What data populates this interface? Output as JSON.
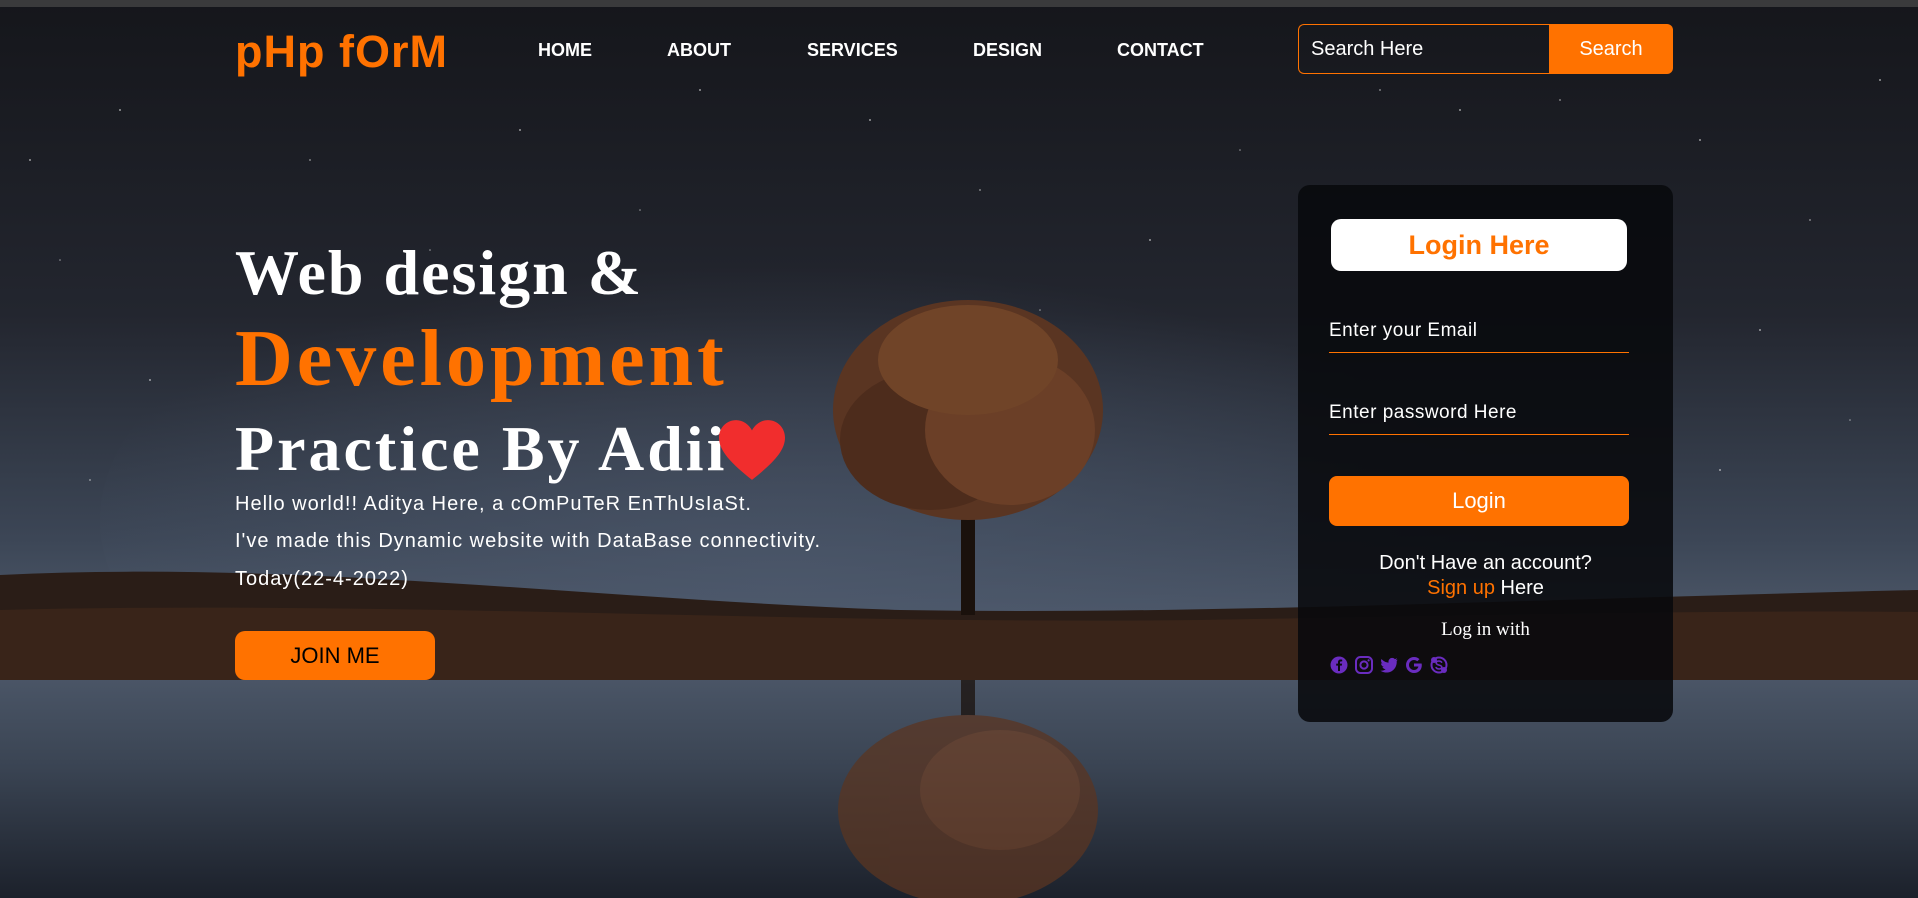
{
  "colors": {
    "accent": "#ff7200",
    "text": "#ffffff",
    "card_bg": "#08090c",
    "social_icon": "#6a2cbf",
    "heart": "#f12d2d"
  },
  "brand": {
    "logo": "pHp fOrM"
  },
  "nav": {
    "items": [
      {
        "label": "HOME"
      },
      {
        "label": "ABOUT"
      },
      {
        "label": "SERVICES"
      },
      {
        "label": "DESIGN"
      },
      {
        "label": "CONTACT"
      }
    ]
  },
  "search": {
    "placeholder": "Search Here",
    "button_label": "Search"
  },
  "hero": {
    "line1": "Web design &",
    "line2": "Development",
    "line3": "Practice By Adii",
    "heart_icon": "heart-icon",
    "paragraphs": [
      "Hello world!! Aditya Here, a cOmPuTeR EnThUsIaSt.",
      "I've made this Dynamic website with DataBase connectivity.",
      "Today(22-4-2022)"
    ],
    "join_label": "JOIN ME"
  },
  "login": {
    "title": "Login Here",
    "email_placeholder": "Enter your Email",
    "password_placeholder": "Enter password Here",
    "button_label": "Login",
    "no_account": "Don't Have an account?",
    "signup_link": "Sign up",
    "signup_suffix": " Here",
    "login_with": "Log in with",
    "social_icons": [
      "facebook-icon",
      "instagram-icon",
      "twitter-icon",
      "google-icon",
      "skype-icon"
    ]
  }
}
